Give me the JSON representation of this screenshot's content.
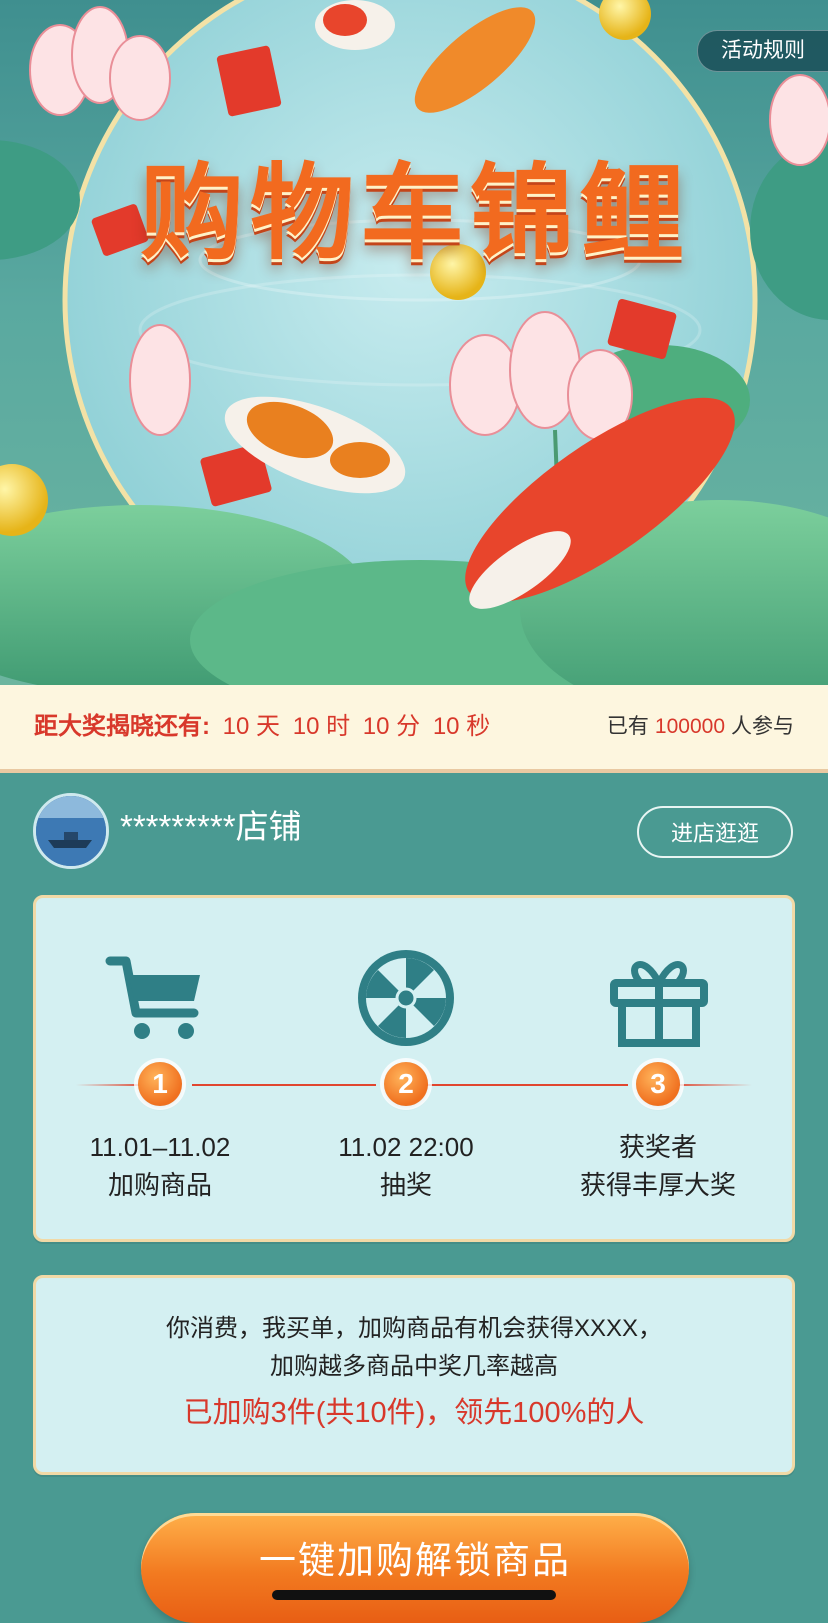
{
  "hero": {
    "title": "购物车锦鲤",
    "rules_label": "活动规则"
  },
  "countdown": {
    "label": "距大奖揭晓还有:",
    "days": "10",
    "days_unit": "天",
    "hours": "10",
    "hours_unit": "时",
    "minutes": "10",
    "minutes_unit": "分",
    "seconds": "10",
    "seconds_unit": "秒",
    "participants_prefix": "已有",
    "participants_count": "100000",
    "participants_suffix": "人参与"
  },
  "shop": {
    "name": "*********店铺",
    "visit_label": "进店逛逛"
  },
  "steps": [
    {
      "number": "1",
      "icon": "shopping-cart-icon",
      "line1": "11.01–11.02",
      "line2": "加购商品"
    },
    {
      "number": "2",
      "icon": "lottery-wheel-icon",
      "line1": "11.02 22:00",
      "line2": "抽奖"
    },
    {
      "number": "3",
      "icon": "gift-icon",
      "line1": "获奖者",
      "line2": "获得丰厚大奖"
    }
  ],
  "info": {
    "line1": "你消费，我买单，加购商品有机会获得XXXX，",
    "line2": "加购越多商品中奖几率越高",
    "status": "已加购3件(共10件)，领先100%的人"
  },
  "cta_label": "一键加购解锁商品",
  "colors": {
    "accent_red": "#d8382b",
    "accent_orange": "#f0701f",
    "teal_bg": "#4a9a92",
    "card_bg": "#d4f0f2",
    "icon_teal": "#2f7f86"
  }
}
